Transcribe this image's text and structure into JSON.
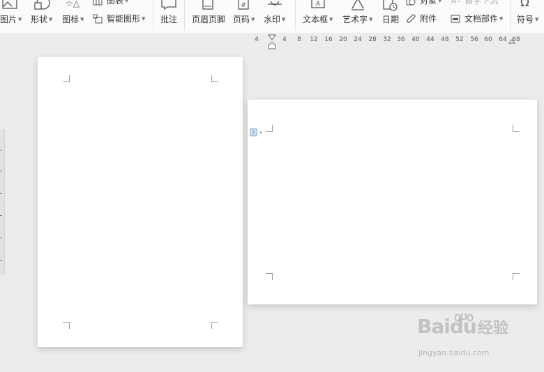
{
  "toolbar": {
    "picture": "图片",
    "shape": "形状",
    "icon": "图标",
    "chart": "图表",
    "smartart": "智能图形",
    "comment": "批注",
    "header_footer": "页眉页脚",
    "page_number": "页码",
    "watermark": "水印",
    "textbox": "文本框",
    "wordart": "艺术字",
    "date": "日期",
    "object": "对象",
    "drop_cap": "首字下沉",
    "attachment": "附件",
    "doc_parts": "文档部件",
    "symbol": "符号"
  },
  "ruler": {
    "ticks": [
      "4",
      "4",
      "8",
      "12",
      "16",
      "20",
      "24",
      "28",
      "32",
      "36",
      "40",
      "44",
      "48",
      "52",
      "56",
      "60",
      "64",
      "68"
    ]
  },
  "watermark": {
    "brand": "Baidu",
    "cn": "经验",
    "url": "jingyan.baidu.com"
  }
}
